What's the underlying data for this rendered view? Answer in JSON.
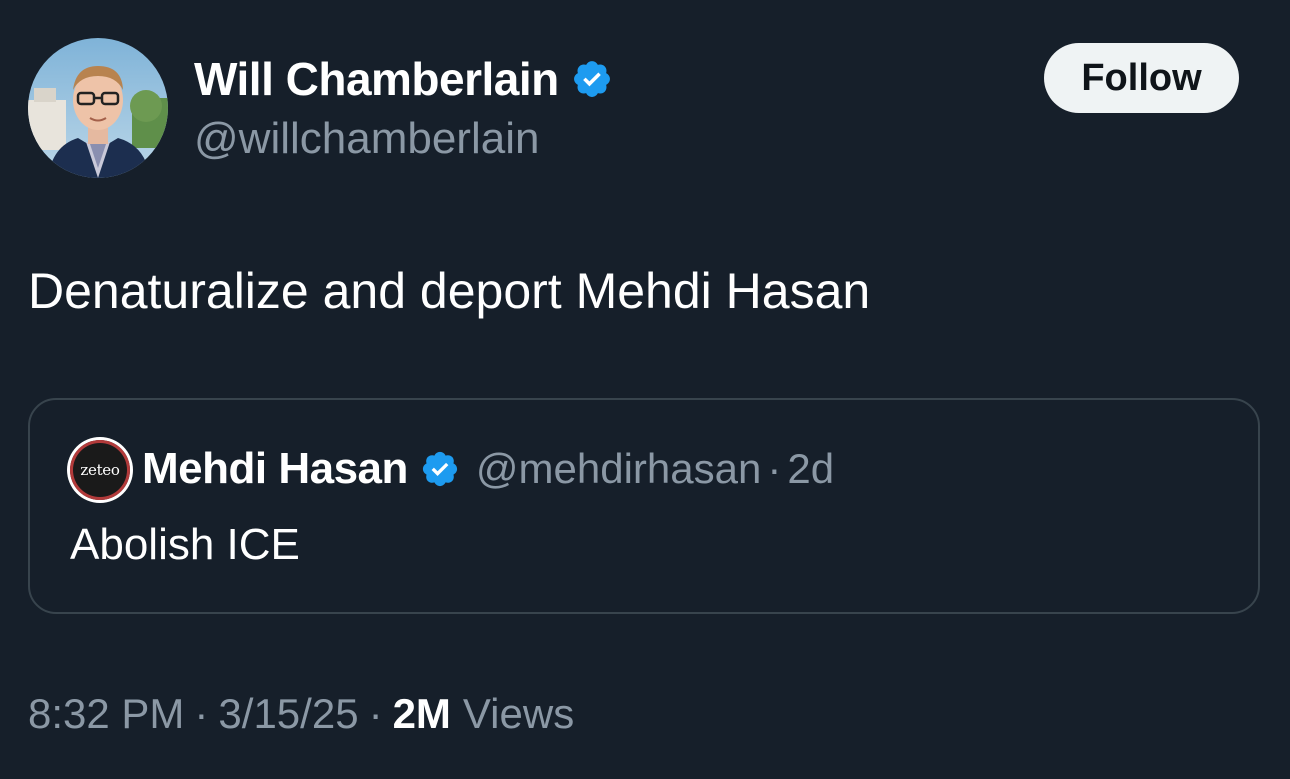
{
  "author": {
    "name": "Will Chamberlain",
    "handle": "@willchamberlain",
    "verified_icon": "verified-badge-icon"
  },
  "follow_button": {
    "label": "Follow"
  },
  "tweet": {
    "text": "Denaturalize and deport Mehdi Hasan"
  },
  "quoted_tweet": {
    "avatar_text": "zeteo",
    "name": "Mehdi Hasan",
    "handle": "@mehdirhasan",
    "separator": "·",
    "time": "2d",
    "text": "Abolish ICE"
  },
  "meta": {
    "time": "8:32 PM",
    "separator": "·",
    "date": "3/15/25",
    "views_count": "2M",
    "views_label": "Views"
  },
  "colors": {
    "background": "#161f2a",
    "secondary_text": "#8b98a5",
    "verified_blue": "#1d9bf0",
    "follow_bg": "#eff3f4",
    "card_border": "#38444d"
  }
}
